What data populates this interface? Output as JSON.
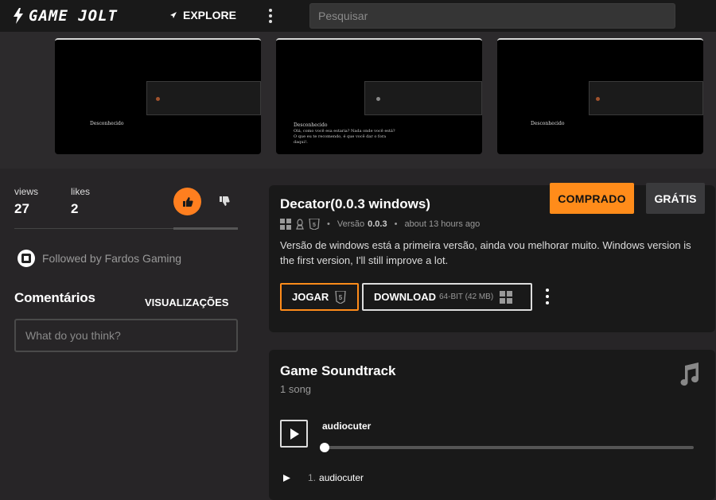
{
  "header": {
    "logo_text": "GAME JOLT",
    "explore_label": "EXPLORE",
    "search_placeholder": "Pesquisar"
  },
  "media": {
    "screenshots": [
      {
        "caption": "Desconhecido",
        "subcaption": ""
      },
      {
        "caption": "Desconhecido",
        "subcaption": "Olá, como você esa estaria? Nada onde você está? O que eu te recomendo, é que você dar o fora daqui!."
      },
      {
        "caption": "Desconhecido",
        "subcaption": ""
      }
    ]
  },
  "stats": {
    "views_label": "views",
    "views_value": "27",
    "likes_label": "likes",
    "likes_value": "2"
  },
  "follow": {
    "text": "Followed by Fardos Gaming"
  },
  "comments": {
    "title": "Comentários",
    "views_link": "VISUALIZAÇÕES",
    "input_placeholder": "What do you think?"
  },
  "build": {
    "title": "Decator(0.0.3 windows)",
    "bought_label": "COMPRADO",
    "free_label": "GRÁTIS",
    "version_label": "Versão",
    "version_value": "0.0.3",
    "time": "about 13 hours ago",
    "description": "Versão de windows está a primeira versão, ainda vou melhorar muito. Windows version is the first version, I'll still improve a lot.",
    "play_label": "JOGAR",
    "download_label": "DOWNLOAD",
    "download_meta": "64-BIT (42 MB)"
  },
  "soundtrack": {
    "title": "Game Soundtrack",
    "count": "1 song",
    "current_track": "audiocuter",
    "tracks": [
      {
        "num": "1.",
        "name": "audiocuter"
      }
    ],
    "progress": 0
  },
  "colors": {
    "accent": "#ff8c1a",
    "like": "#ff7f1f",
    "background": "#272527",
    "card": "#191919"
  }
}
